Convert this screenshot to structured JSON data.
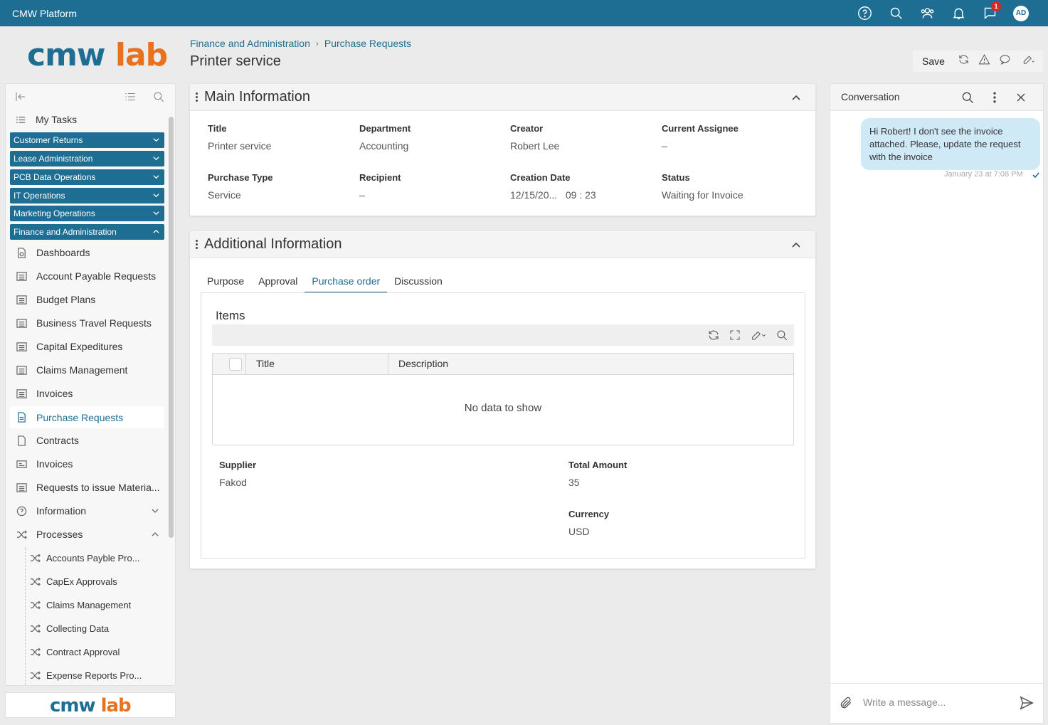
{
  "app": {
    "title": "CMW Platform"
  },
  "topbar": {
    "notification_count": "1",
    "avatar_initials": "AD",
    "icons": [
      "help-icon",
      "search-icon",
      "users-icon",
      "bell-icon",
      "chat-icon"
    ]
  },
  "logo": {
    "part1": "cmw",
    "part2": "lab"
  },
  "breadcrumb": {
    "level1": "Finance and Administration",
    "level2": "Purchase Requests"
  },
  "page": {
    "title": "Printer service"
  },
  "toolbar": {
    "save_label": "Save"
  },
  "sidebar": {
    "my_tasks": "My Tasks",
    "groups": [
      {
        "label": "Customer Returns"
      },
      {
        "label": "Lease Administration"
      },
      {
        "label": "PCB Data Operations"
      },
      {
        "label": "IT Operations"
      },
      {
        "label": "Marketing Operations"
      },
      {
        "label": "Finance and Administration"
      }
    ],
    "items": [
      {
        "label": "Dashboards",
        "icon": "dashboard-icon"
      },
      {
        "label": "Account Payable Requests",
        "icon": "list-icon"
      },
      {
        "label": "Budget Plans",
        "icon": "list-icon"
      },
      {
        "label": "Business Travel Requests",
        "icon": "list-icon"
      },
      {
        "label": "Capital Expeditures",
        "icon": "list-icon"
      },
      {
        "label": "Claims Management",
        "icon": "list-icon"
      },
      {
        "label": "Invoices",
        "icon": "list-icon"
      },
      {
        "label": "Purchase Requests",
        "icon": "document-icon"
      },
      {
        "label": "Contracts",
        "icon": "document-icon"
      },
      {
        "label": "Invoices",
        "icon": "card-icon"
      },
      {
        "label": "Requests to issue Materia...",
        "icon": "list-icon"
      },
      {
        "label": "Information",
        "icon": "info-icon"
      },
      {
        "label": "Processes",
        "icon": "process-icon"
      }
    ],
    "processes": [
      {
        "label": "Accounts Payble Pro..."
      },
      {
        "label": "CapEx Approvals"
      },
      {
        "label": "Claims Management"
      },
      {
        "label": "Collecting Data"
      },
      {
        "label": "Contract Approval"
      },
      {
        "label": "Expense Reports Pro..."
      }
    ]
  },
  "main_info": {
    "title": "Main Information",
    "fields": [
      {
        "label": "Title",
        "value": "Printer service"
      },
      {
        "label": "Department",
        "value": "Accounting"
      },
      {
        "label": "Creator",
        "value": "Robert Lee"
      },
      {
        "label": "Current Assignee",
        "value": "–"
      },
      {
        "label": "Purchase Type",
        "value": "Service"
      },
      {
        "label": "Recipient",
        "value": "–"
      },
      {
        "label": "Creation Date",
        "value": "12/15/20...   09 : 23"
      },
      {
        "label": "Status",
        "value": "Waiting for Invoice"
      }
    ]
  },
  "additional_info": {
    "title": "Additional Information",
    "tabs": [
      "Purpose",
      "Approval",
      "Purchase order",
      "Discussion"
    ],
    "active_tab": "Purchase order",
    "items": {
      "title": "Items",
      "columns": [
        "Title",
        "Description"
      ],
      "empty_text": "No data to show"
    },
    "fields": [
      {
        "label": "Supplier",
        "value": "Fakod"
      },
      {
        "label": "Total Amount",
        "value": "35"
      },
      {
        "label": "Currency",
        "value": "USD"
      }
    ]
  },
  "conversation": {
    "title": "Conversation",
    "message": "Hi Robert! I don't see the invoice attached. Please, update the request with the invoice",
    "time": "January 23 at 7:08 PM",
    "input_placeholder": "Write a message..."
  },
  "colors": {
    "brand": "#1e6e94",
    "accent": "#e8711e",
    "bubble": "#cfe9f7"
  }
}
